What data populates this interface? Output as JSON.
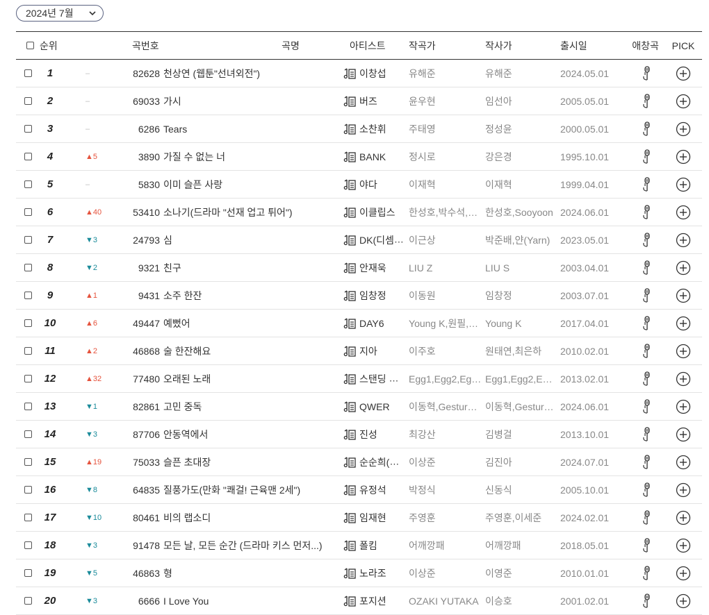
{
  "filter": {
    "month_label": "2024년 7월"
  },
  "headers": {
    "rank": "순위",
    "song_no": "곡번호",
    "title": "곡명",
    "artist": "아티스트",
    "composer": "작곡가",
    "lyricist": "작사가",
    "release": "출시일",
    "fav": "애창곡",
    "pick": "PICK"
  },
  "colors": {
    "up": "#e5533d",
    "down": "#1a8b9a",
    "same": "#bbbbbb",
    "header_border": "#333333"
  },
  "icons": {
    "lyrics": "music-note-lyrics-icon",
    "fav": "microphone-icon",
    "pick": "plus-circle-icon",
    "dropdown": "chevron-down-icon"
  },
  "rows": [
    {
      "rank": "1",
      "change": "–",
      "dir": "same",
      "no": "82628",
      "title": "천상연 (웹툰\"선녀외전\")",
      "artist": "이창섭",
      "composer": "유해준",
      "lyricist": "유해준",
      "date": "2024.05.01"
    },
    {
      "rank": "2",
      "change": "–",
      "dir": "same",
      "no": "69033",
      "title": "가시",
      "artist": "버즈",
      "composer": "윤우현",
      "lyricist": "임선아",
      "date": "2005.05.01"
    },
    {
      "rank": "3",
      "change": "–",
      "dir": "same",
      "no": "6286",
      "title": "Tears",
      "artist": "소찬휘",
      "composer": "주태영",
      "lyricist": "정성윤",
      "date": "2000.05.01"
    },
    {
      "rank": "4",
      "change": "▲5",
      "dir": "up",
      "no": "3890",
      "title": "가질 수 없는 너",
      "artist": "BANK",
      "composer": "정시로",
      "lyricist": "강은경",
      "date": "1995.10.01"
    },
    {
      "rank": "5",
      "change": "–",
      "dir": "same",
      "no": "5830",
      "title": "이미 슬픈 사랑",
      "artist": "야다",
      "composer": "이재혁",
      "lyricist": "이재혁",
      "date": "1999.04.01"
    },
    {
      "rank": "6",
      "change": "▲40",
      "dir": "up",
      "no": "53410",
      "title": "소나기(드라마 \"선재 업고 튀어\")",
      "artist": "이클립스",
      "composer": "한성호,박수석,…",
      "lyricist": "한성호,Sooyoon",
      "date": "2024.06.01"
    },
    {
      "rank": "7",
      "change": "▼3",
      "dir": "down",
      "no": "24793",
      "title": "심",
      "artist": "DK(디셈버)",
      "composer": "이근상",
      "lyricist": "박준배,얀(Yarn)",
      "date": "2023.05.01"
    },
    {
      "rank": "8",
      "change": "▼2",
      "dir": "down",
      "no": "9321",
      "title": "친구",
      "artist": "안재욱",
      "composer": "LIU Z",
      "lyricist": "LIU S",
      "date": "2003.04.01"
    },
    {
      "rank": "9",
      "change": "▲1",
      "dir": "up",
      "no": "9431",
      "title": "소주 한잔",
      "artist": "임창정",
      "composer": "이동원",
      "lyricist": "임창정",
      "date": "2003.07.01"
    },
    {
      "rank": "10",
      "change": "▲6",
      "dir": "up",
      "no": "49447",
      "title": "예뻤어",
      "artist": "DAY6",
      "composer": "Young K,원필,…",
      "lyricist": "Young K",
      "date": "2017.04.01"
    },
    {
      "rank": "11",
      "change": "▲2",
      "dir": "up",
      "no": "46868",
      "title": "술 한잔해요",
      "artist": "지아",
      "composer": "이주호",
      "lyricist": "원태연,최은하",
      "date": "2010.02.01"
    },
    {
      "rank": "12",
      "change": "▲32",
      "dir": "up",
      "no": "77480",
      "title": "오래된 노래",
      "artist": "스탠딩 에그",
      "composer": "Egg1,Egg2,Eg…",
      "lyricist": "Egg1,Egg2,Eg…",
      "date": "2013.02.01"
    },
    {
      "rank": "13",
      "change": "▼1",
      "dir": "down",
      "no": "82861",
      "title": "고민 중독",
      "artist": "QWER",
      "composer": "이동혁,Gestur…",
      "lyricist": "이동혁,Gestur…",
      "date": "2024.06.01"
    },
    {
      "rank": "14",
      "change": "▼3",
      "dir": "down",
      "no": "87706",
      "title": "안동역에서",
      "artist": "진성",
      "composer": "최강산",
      "lyricist": "김병걸",
      "date": "2013.10.01"
    },
    {
      "rank": "15",
      "change": "▲19",
      "dir": "up",
      "no": "75033",
      "title": "슬픈 초대장",
      "artist": "순순희(지환)",
      "composer": "이상준",
      "lyricist": "김진아",
      "date": "2024.07.01"
    },
    {
      "rank": "16",
      "change": "▼8",
      "dir": "down",
      "no": "64835",
      "title": "질풍가도(만화 \"쾌걸! 근육맨 2세\")",
      "artist": "유정석",
      "composer": "박정식",
      "lyricist": "신동식",
      "date": "2005.10.01"
    },
    {
      "rank": "17",
      "change": "▼10",
      "dir": "down",
      "no": "80461",
      "title": "비의 랩소디",
      "artist": "임재현",
      "composer": "주영훈",
      "lyricist": "주영훈,이세준",
      "date": "2024.02.01"
    },
    {
      "rank": "18",
      "change": "▼3",
      "dir": "down",
      "no": "91478",
      "title": "모든 날, 모든 순간 (드라마 키스 먼저...)",
      "artist": "폴킴",
      "composer": "어깨깡패",
      "lyricist": "어깨깡패",
      "date": "2018.05.01"
    },
    {
      "rank": "19",
      "change": "▼5",
      "dir": "down",
      "no": "46863",
      "title": "형",
      "artist": "노라조",
      "composer": "이상준",
      "lyricist": "이영준",
      "date": "2010.01.01"
    },
    {
      "rank": "20",
      "change": "▼3",
      "dir": "down",
      "no": "6666",
      "title": "I Love You",
      "artist": "포지션",
      "composer": "OZAKI YUTAKA",
      "lyricist": "이승호",
      "date": "2001.02.01"
    }
  ]
}
